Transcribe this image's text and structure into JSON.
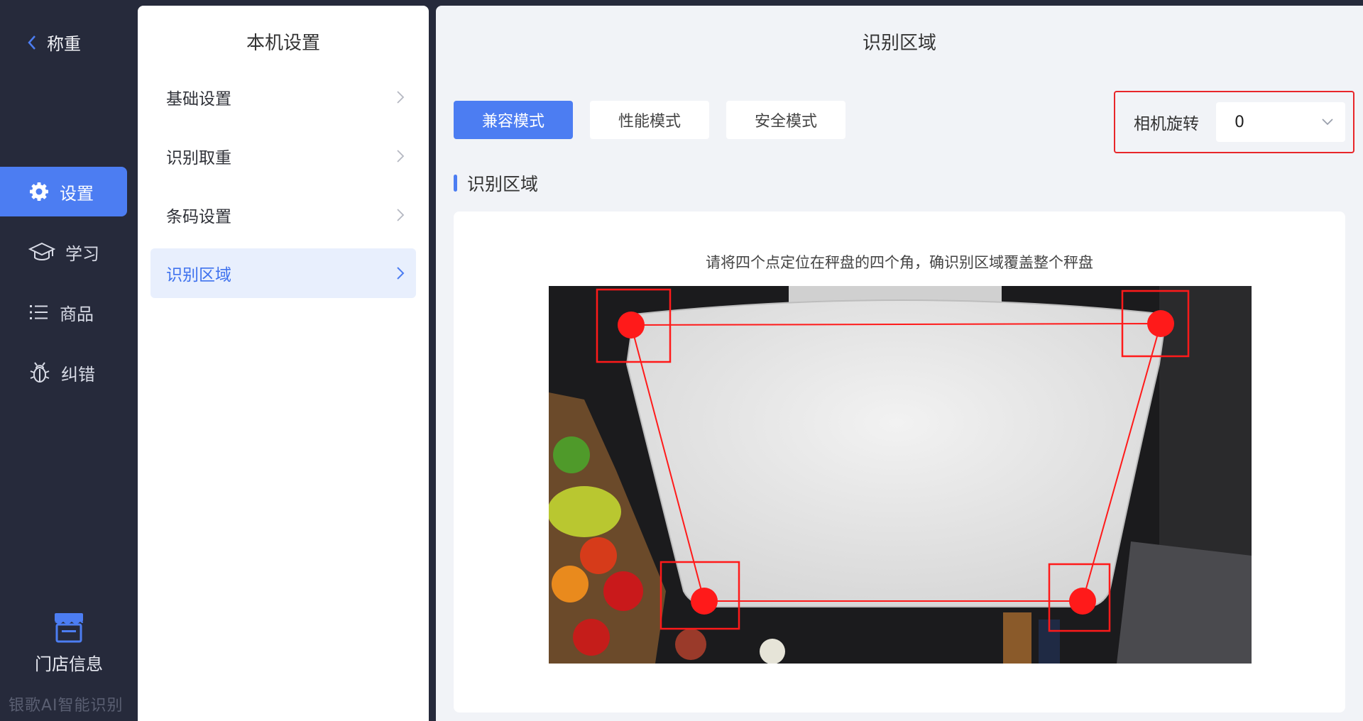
{
  "nav": {
    "back_label": "称重",
    "items": [
      {
        "label": "设置",
        "icon": "gear-icon",
        "active": true
      },
      {
        "label": "学习",
        "icon": "graduation-cap-icon",
        "active": false
      },
      {
        "label": "商品",
        "icon": "list-icon",
        "active": false
      },
      {
        "label": "纠错",
        "icon": "bug-icon",
        "active": false
      }
    ],
    "store_label": "门店信息",
    "store_icon": "store-icon",
    "watermark": "银歌AI智能识别"
  },
  "settings_menu": {
    "title": "本机设置",
    "items": [
      {
        "label": "基础设置",
        "active": false
      },
      {
        "label": "识别取重",
        "active": false
      },
      {
        "label": "条码设置",
        "active": false
      },
      {
        "label": "识别区域",
        "active": true
      }
    ]
  },
  "main": {
    "title": "识别区域",
    "modes": [
      {
        "label": "兼容模式",
        "active": true
      },
      {
        "label": "性能模式",
        "active": false
      },
      {
        "label": "安全模式",
        "active": false
      }
    ],
    "rotation": {
      "label": "相机旋转",
      "value": "0"
    },
    "section_title": "识别区域",
    "hint": "请将四个点定位在秤盘的四个角，确识别区域覆盖整个秤盘",
    "corner_count": 4
  },
  "colors": {
    "accent": "#4c7df2",
    "nav_bg": "#262a3b",
    "marker": "#ff1a1a",
    "highlight_border": "#e8262a"
  }
}
